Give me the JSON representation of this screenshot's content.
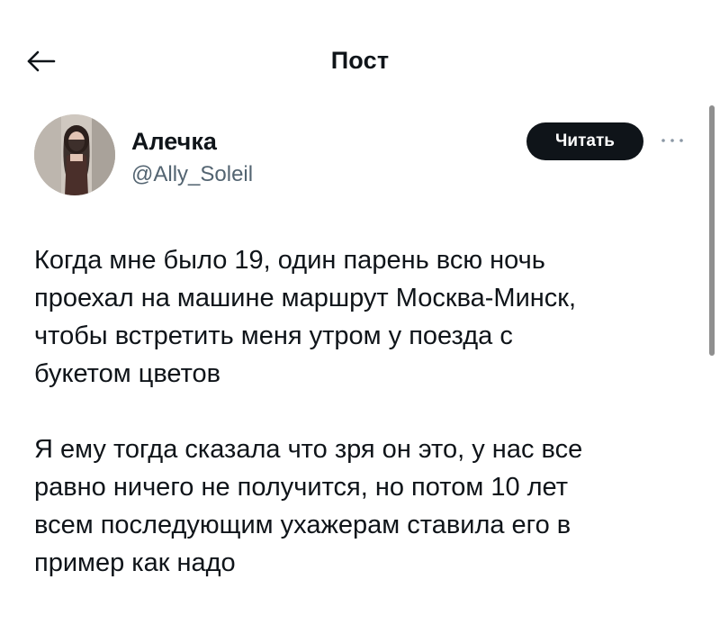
{
  "header": {
    "title": "Пост",
    "back_icon": "arrow-left-icon"
  },
  "author": {
    "name": "Алечка",
    "handle": "@Ally_Soleil",
    "follow_label": "Читать",
    "more_icon": "more-dots-icon"
  },
  "post": {
    "paragraph_1": "Когда мне было 19, один парень всю ночь\nпроехал на машине маршрут Москва-Минск,\nчтобы встретить меня утром у поезда с\nбукетом цветов",
    "paragraph_2": "Я ему тогда сказала что зря он это, у нас все\nравно ничего не получится, но потом 10 лет\nвсем последующим ухажерам ставила его в\nпример как надо"
  },
  "colors": {
    "text": "#0f1419",
    "secondary": "#536471",
    "button_bg": "#0f1419",
    "button_text": "#ffffff"
  }
}
